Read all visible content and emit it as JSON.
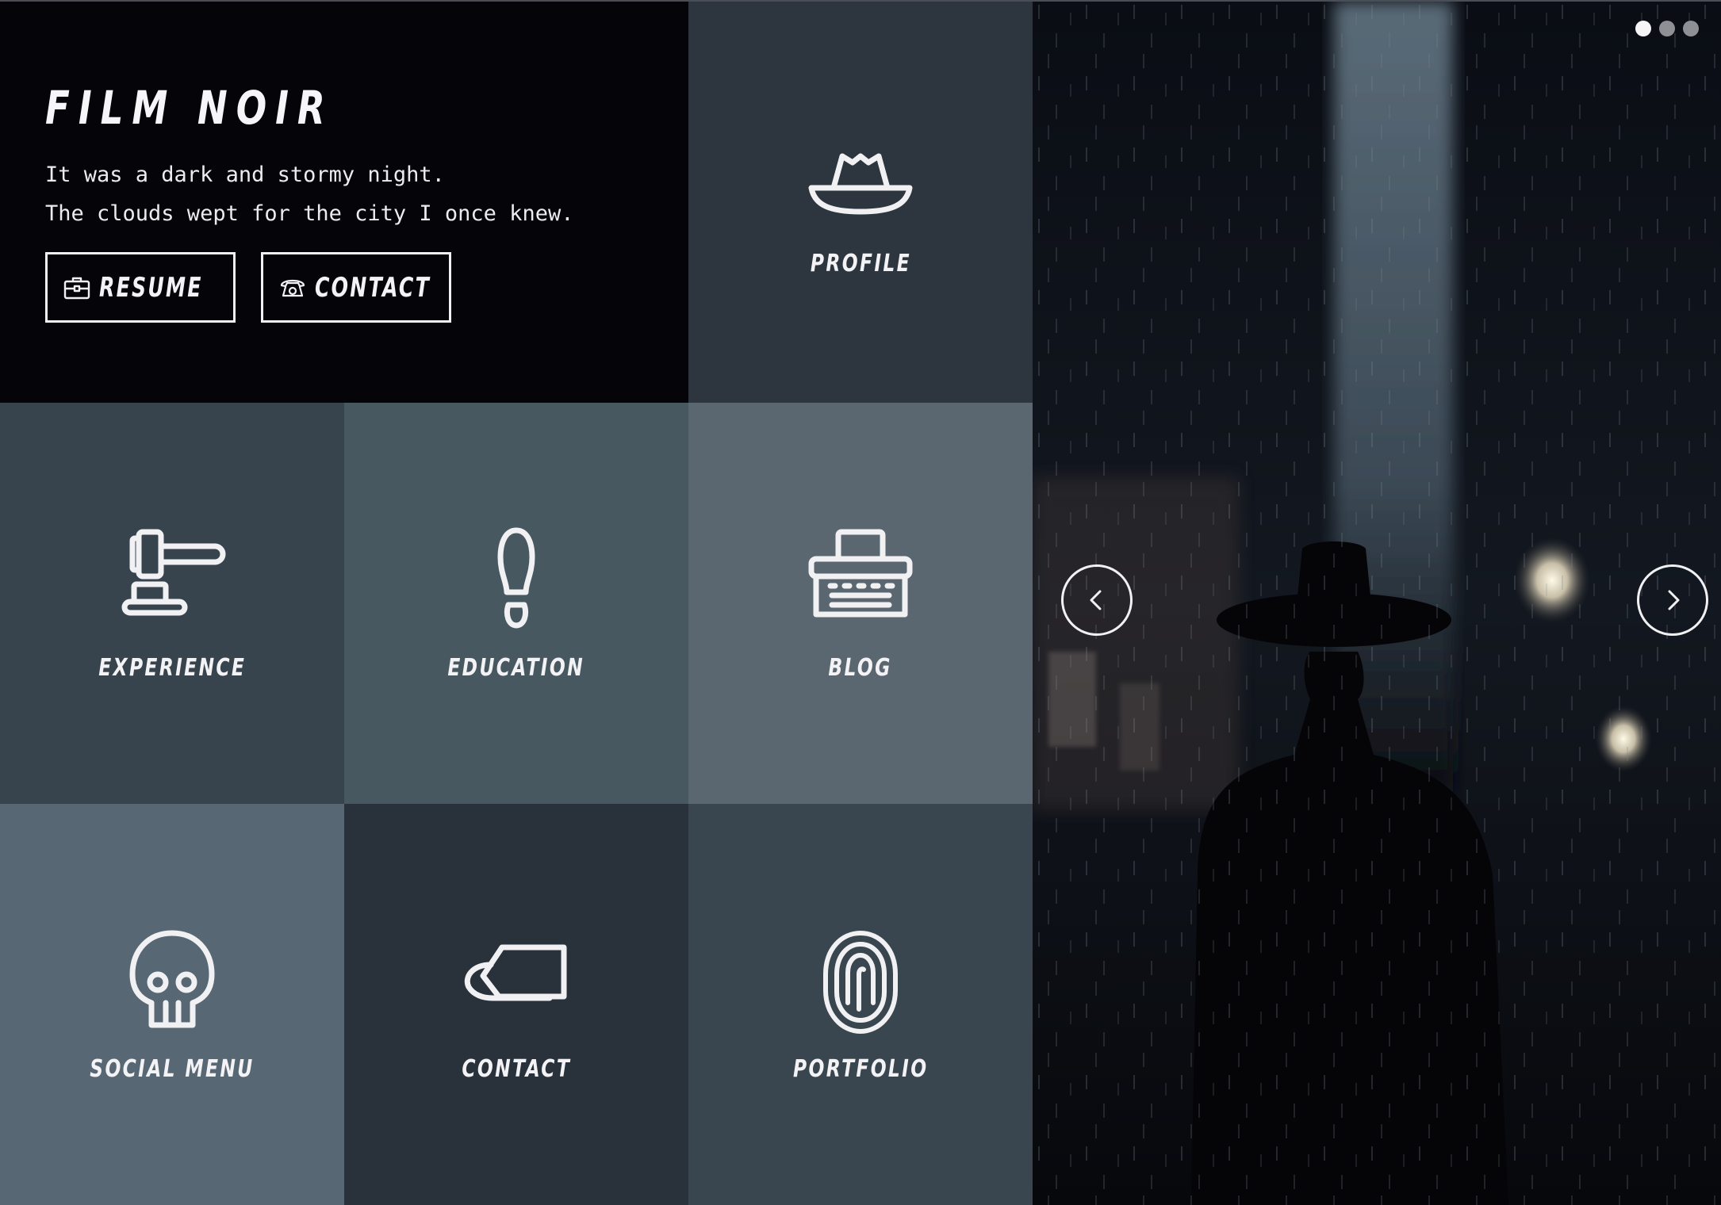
{
  "theme": {
    "intro_bg": "#050509",
    "profile_bg": "#2d363e",
    "experience_bg": "#38444d",
    "education_bg": "#485861",
    "blog_bg": "#5a6670",
    "social_bg": "#576874",
    "contact_bg": "#29313a",
    "portfolio_bg": "#3a464f",
    "icon_color": "#f1f1f4"
  },
  "intro": {
    "title": "FILM NOIR",
    "line1": "It was a dark and stormy night.",
    "line2": "The clouds wept for the city I once knew.",
    "buttons": [
      {
        "label": "RESUME",
        "icon": "briefcase-icon"
      },
      {
        "label": "CONTACT",
        "icon": "rotary-phone-icon"
      }
    ]
  },
  "tiles": {
    "profile": {
      "label": "PROFILE",
      "icon": "fedora-hat-icon"
    },
    "experience": {
      "label": "EXPERIENCE",
      "icon": "gavel-icon"
    },
    "education": {
      "label": "EDUCATION",
      "icon": "footprint-icon"
    },
    "blog": {
      "label": "BLOG",
      "icon": "typewriter-icon"
    },
    "social": {
      "label": "SOCIAL MENU",
      "icon": "skull-icon"
    },
    "contact": {
      "label": "CONTACT",
      "icon": "tag-icon"
    },
    "portfolio": {
      "label": "PORTFOLIO",
      "icon": "fingerprint-icon"
    }
  },
  "slider": {
    "current": 1,
    "total": 3,
    "prev_icon": "chevron-left-icon",
    "next_icon": "chevron-right-icon"
  }
}
